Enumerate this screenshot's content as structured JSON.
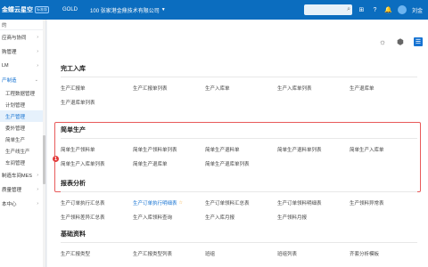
{
  "topbar": {
    "logo": "金蝶云星空",
    "edition": "标准版",
    "gold": "GOLD",
    "company": "100 张家港金鼎技术有限公司",
    "user": "刘金"
  },
  "sidebar": {
    "head": "的",
    "items": [
      {
        "label": "应商与协同",
        "type": "row"
      },
      {
        "label": "购管理",
        "type": "row"
      },
      {
        "label": "LM",
        "type": "row"
      },
      {
        "label": "产制造",
        "type": "row-open"
      },
      {
        "label": "工程数据管理",
        "type": "sub"
      },
      {
        "label": "计划管理",
        "type": "sub"
      },
      {
        "label": "生产管理",
        "type": "sub-active"
      },
      {
        "label": "委外管理",
        "type": "sub"
      },
      {
        "label": "简单生产",
        "type": "sub"
      },
      {
        "label": "生产线生产",
        "type": "sub"
      },
      {
        "label": "车间管理",
        "type": "sub"
      },
      {
        "label": "制造车间MES",
        "type": "row"
      },
      {
        "label": "质量管理",
        "type": "row"
      },
      {
        "label": "本中心",
        "type": "row"
      }
    ]
  },
  "sections": {
    "s1": {
      "title": "完工入库",
      "items": [
        "生产汇报单",
        "生产汇报单列表",
        "生产入库单",
        "生产入库单列表",
        "生产退库单",
        "生产退库单列表"
      ]
    },
    "s2": {
      "title": "简单生产",
      "badge": "1",
      "items": [
        "简单生产领料单",
        "简单生产领料单列表",
        "简单生产退料单",
        "简单生产退料单列表",
        "简单生产入库单",
        "简单生产入库单列表",
        "简单生产退库单",
        "简单生产退库单列表"
      ]
    },
    "s3": {
      "title": "报表分析",
      "items": [
        "生产订单执行汇总表",
        "生产订单执行明细表",
        "生产订单领料汇总表",
        "生产订单领料明细表",
        "生产领料异常表",
        "生产领料差异汇总表",
        "生产入库领料查询",
        "生产入库月报",
        "生产领料月报"
      ]
    },
    "s4": {
      "title": "基础资料",
      "items": [
        "生产汇报类型",
        "生产汇报类型列表",
        "班组",
        "班组列表",
        "齐套分析模板"
      ]
    }
  }
}
